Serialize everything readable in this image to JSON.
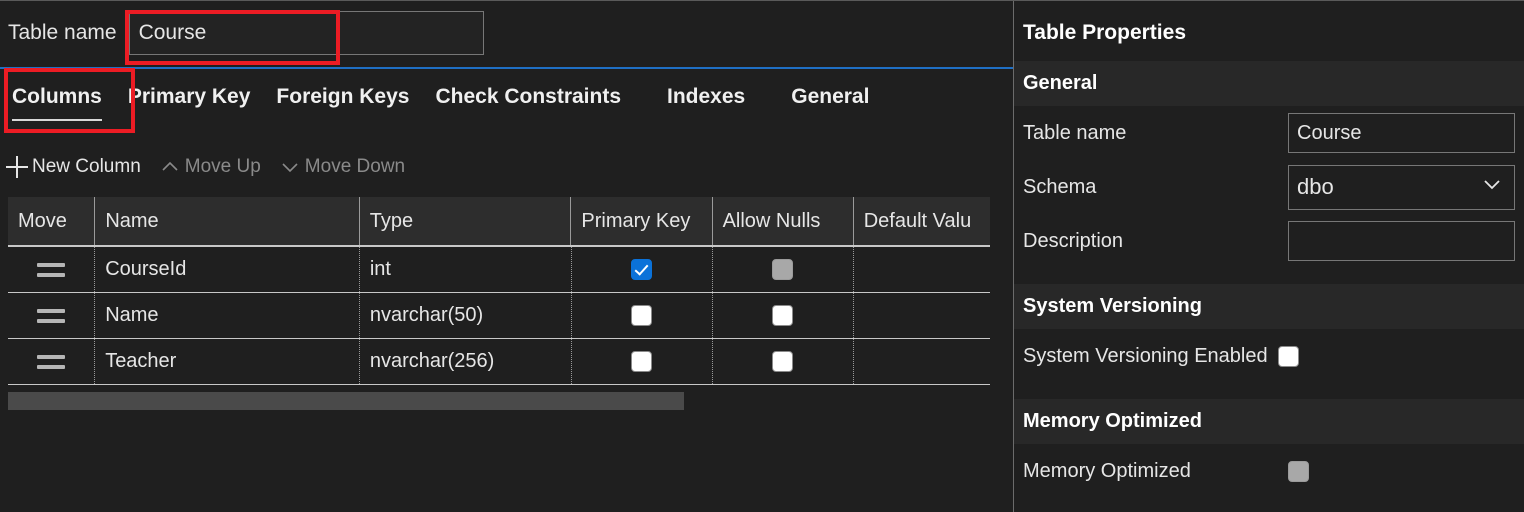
{
  "table_designer": {
    "table_name_label": "Table name",
    "table_name_value": "Course",
    "tabs": [
      {
        "label": "Columns",
        "active": true
      },
      {
        "label": "Primary Key",
        "active": false
      },
      {
        "label": "Foreign Keys",
        "active": false
      },
      {
        "label": "Check Constraints",
        "active": false
      },
      {
        "label": "Indexes",
        "active": false
      },
      {
        "label": "General",
        "active": false
      }
    ],
    "toolbar": {
      "new_column": "New Column",
      "move_up": "Move Up",
      "move_down": "Move Down",
      "new_column_icon": "plus-icon",
      "move_up_icon": "chevron-up-icon",
      "move_down_icon": "chevron-down-icon"
    },
    "grid": {
      "columns": [
        "Move",
        "Name",
        "Type",
        "Primary Key",
        "Allow Nulls",
        "Default Valu"
      ],
      "rows": [
        {
          "move": "drag-handle",
          "name": "CourseId",
          "type": "int",
          "primary_key": true,
          "primary_key_disabled": false,
          "allow_nulls": false,
          "allow_nulls_disabled": true,
          "default_value": ""
        },
        {
          "move": "drag-handle",
          "name": "Name",
          "type": "nvarchar(50)",
          "primary_key": false,
          "primary_key_disabled": false,
          "allow_nulls": false,
          "allow_nulls_disabled": false,
          "default_value": ""
        },
        {
          "move": "drag-handle",
          "name": "Teacher",
          "type": "nvarchar(256)",
          "primary_key": false,
          "primary_key_disabled": false,
          "allow_nulls": false,
          "allow_nulls_disabled": false,
          "default_value": ""
        }
      ]
    }
  },
  "properties_panel": {
    "title": "Table Properties",
    "sections": {
      "general": {
        "heading": "General",
        "table_name_label": "Table name",
        "table_name_value": "Course",
        "schema_label": "Schema",
        "schema_value": "dbo",
        "schema_chevron_icon": "chevron-down-icon",
        "description_label": "Description",
        "description_value": ""
      },
      "system_versioning": {
        "heading": "System Versioning",
        "enabled_label": "System Versioning Enabled",
        "enabled_value": false
      },
      "memory_optimized": {
        "heading": "Memory Optimized",
        "memory_optimized_label": "Memory Optimized",
        "memory_optimized_value": false,
        "memory_optimized_disabled": true
      }
    }
  },
  "annotations": {
    "highlight_color": "#ec1c24",
    "boxes": [
      {
        "name": "table-name-input-highlight"
      },
      {
        "name": "columns-tab-highlight"
      }
    ]
  },
  "theme": {
    "background": "#1f1f1f",
    "header_background": "#2d2d2d",
    "accent_blue": "#1f6fc4",
    "checkbox_checked": "#0b72d9"
  }
}
